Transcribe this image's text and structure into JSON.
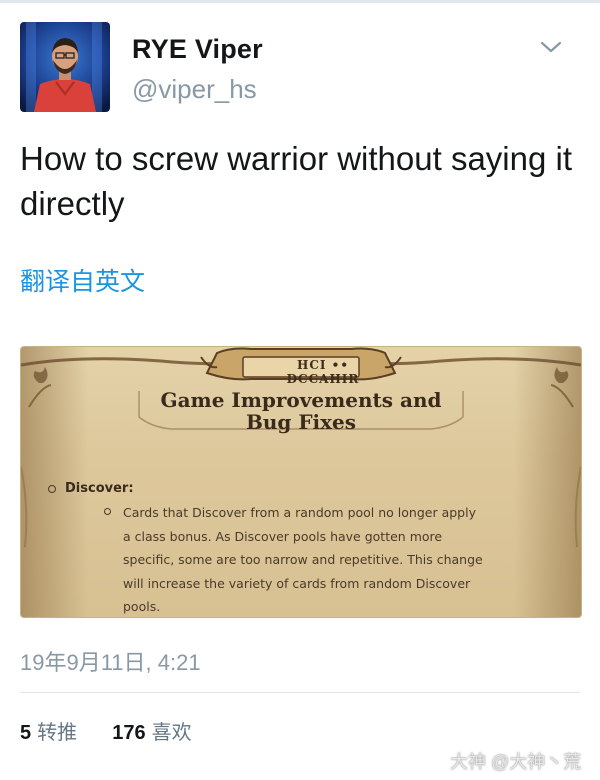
{
  "author": {
    "name": "RYE Viper",
    "handle": "@viper_hs"
  },
  "tweet": {
    "text": "How to screw warrior without saying it directly",
    "translate_label": "翻译自英文",
    "timestamp": "19年9月11日, 4:21"
  },
  "media": {
    "plaque_text": "HCI •• DCCAHIR",
    "title": "Game Improvements and Bug Fixes",
    "section_label": "Discover:",
    "section_body": "Cards that Discover from a random pool no longer apply a class bonus. As Discover pools have gotten more specific, some are too narrow and repetitive. This change will increase the variety of cards from random Discover pools."
  },
  "stats": {
    "retweets_count": "5",
    "retweets_label": "转推",
    "likes_count": "176",
    "likes_label": "喜欢"
  },
  "watermark": "大神 @大神丶荒",
  "icons": {
    "menu": "chevron-down-icon"
  },
  "colors": {
    "link": "#1b95e0",
    "secondary_text": "#8899a6",
    "parchment": "#ddc89c"
  }
}
